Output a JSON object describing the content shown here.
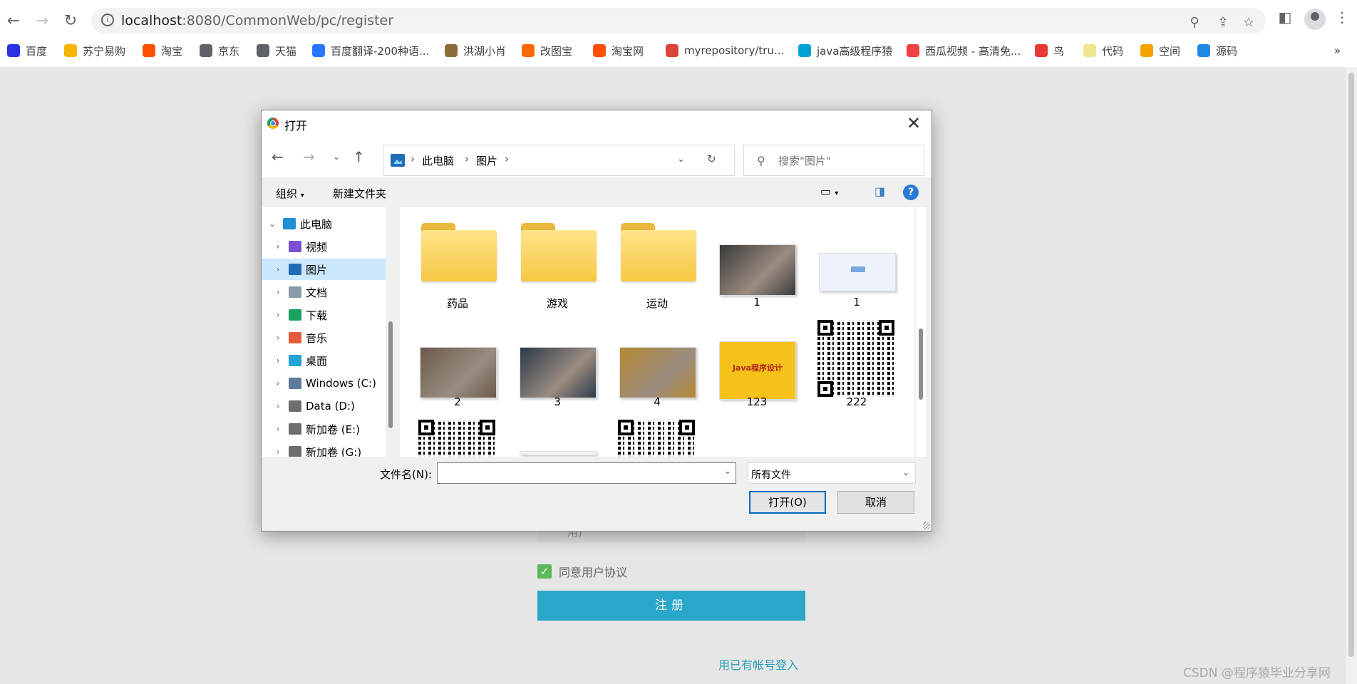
{
  "browser": {
    "url_host": "localhost",
    "url_path": ":8080/CommonWeb/pc/register",
    "bookmarks": [
      {
        "label": "百度",
        "color": "#2932e1"
      },
      {
        "label": "苏宁易购",
        "color": "#f7b500"
      },
      {
        "label": "淘宝",
        "color": "#ff5000"
      },
      {
        "label": "京东",
        "color": "#5f6368"
      },
      {
        "label": "天猫",
        "color": "#5f6368"
      },
      {
        "label": "百度翻译-200种语...",
        "color": "#2878ff"
      },
      {
        "label": "洪湖小肖",
        "color": "#8a6d3b"
      },
      {
        "label": "改图宝",
        "color": "#ff6a00"
      },
      {
        "label": "淘宝网",
        "color": "#ff5000"
      },
      {
        "label": "myrepository/tru...",
        "color": "#db4437"
      },
      {
        "label": "java高级程序猿",
        "color": "#00a1d6"
      },
      {
        "label": "西瓜视频 - 高清免...",
        "color": "#f04142"
      },
      {
        "label": "鸟",
        "color": "#e53935"
      },
      {
        "label": "代码",
        "color": "#f0e68c"
      },
      {
        "label": "空间",
        "color": "#f4a300"
      },
      {
        "label": "源码",
        "color": "#1e88e5"
      }
    ],
    "more": "»"
  },
  "dialog": {
    "title": "打开",
    "breadcrumb": [
      "此电脑",
      "图片"
    ],
    "search_placeholder": "搜索\"图片\"",
    "toolbar": {
      "organize": "组织",
      "new_folder": "新建文件夹"
    },
    "tree": [
      {
        "label": "此电脑",
        "expanded": true,
        "color": "#1e90d6"
      },
      {
        "label": "视频",
        "color": "#7b4fcf"
      },
      {
        "label": "图片",
        "selected": true,
        "color": "#1f6cb5"
      },
      {
        "label": "文档",
        "color": "#8c9aa8"
      },
      {
        "label": "下载",
        "color": "#1aa260"
      },
      {
        "label": "音乐",
        "color": "#e35d3b"
      },
      {
        "label": "桌面",
        "color": "#22a3d9"
      },
      {
        "label": "Windows (C:)",
        "color": "#5c7a99"
      },
      {
        "label": "Data (D:)",
        "color": "#6d6d6d"
      },
      {
        "label": "新加卷 (E:)",
        "color": "#6d6d6d"
      },
      {
        "label": "新加卷 (G:)",
        "color": "#6d6d6d"
      }
    ],
    "files": [
      {
        "name": "药品",
        "kind": "folder"
      },
      {
        "name": "游戏",
        "kind": "folder"
      },
      {
        "name": "运动",
        "kind": "folder"
      },
      {
        "name": "1",
        "kind": "photo",
        "color": "#3a3a3a"
      },
      {
        "name": "1",
        "kind": "diagram",
        "color": "#eef3fb"
      },
      {
        "name": "2",
        "kind": "photo",
        "color": "#6b5a4e"
      },
      {
        "name": "3",
        "kind": "photo",
        "color": "#2d3a4a"
      },
      {
        "name": "4",
        "kind": "photo",
        "color": "#b68a32"
      },
      {
        "name": "123",
        "kind": "banner",
        "color": "#f6c21a",
        "text": "Java程序设计"
      },
      {
        "name": "222",
        "kind": "qr"
      },
      {
        "name": "",
        "kind": "qr"
      },
      {
        "name": "",
        "kind": "blank"
      },
      {
        "name": "",
        "kind": "qr"
      }
    ],
    "filename_label": "文件名(N):",
    "filename_value": "",
    "filetype": "所有文件",
    "open_button": "打开(O)",
    "cancel_button": "取消"
  },
  "page": {
    "field_hint": "用)",
    "agree_label": "同意用户协议",
    "register_button": "注册",
    "login_link": "用已有帐号登入",
    "watermark": "CSDN @程序猿毕业分享网"
  }
}
